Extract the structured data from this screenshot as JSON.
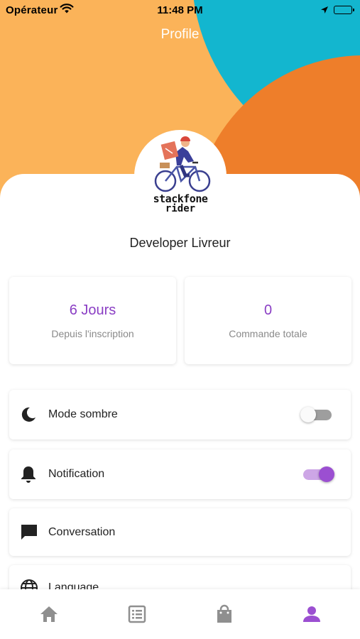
{
  "status_bar": {
    "carrier": "Opérateur",
    "time": "11:48 PM"
  },
  "header": {
    "title": "Profile",
    "colors": {
      "background": "#fbb359",
      "teal": "#13b6cf",
      "orange": "#ee7e2a"
    }
  },
  "profile": {
    "avatar_logo_line1": "stackfone",
    "avatar_logo_line2": "rider",
    "name": "Developer Livreur"
  },
  "stats": [
    {
      "value": "6 Jours",
      "label": "Depuis l'inscription"
    },
    {
      "value": "0",
      "label": "Commande totale"
    }
  ],
  "settings": [
    {
      "icon": "moon-icon",
      "label": "Mode sombre",
      "toggle": "off"
    },
    {
      "icon": "bell-icon",
      "label": "Notification",
      "toggle": "on"
    },
    {
      "icon": "chat-icon",
      "label": "Conversation"
    },
    {
      "icon": "globe-icon",
      "label": "Language"
    }
  ],
  "bottom_nav": [
    {
      "icon": "home-icon",
      "active": false
    },
    {
      "icon": "list-icon",
      "active": false
    },
    {
      "icon": "shopping-bag-icon",
      "active": false
    },
    {
      "icon": "person-icon",
      "active": true
    }
  ],
  "accent_color": "#8a3ec4"
}
